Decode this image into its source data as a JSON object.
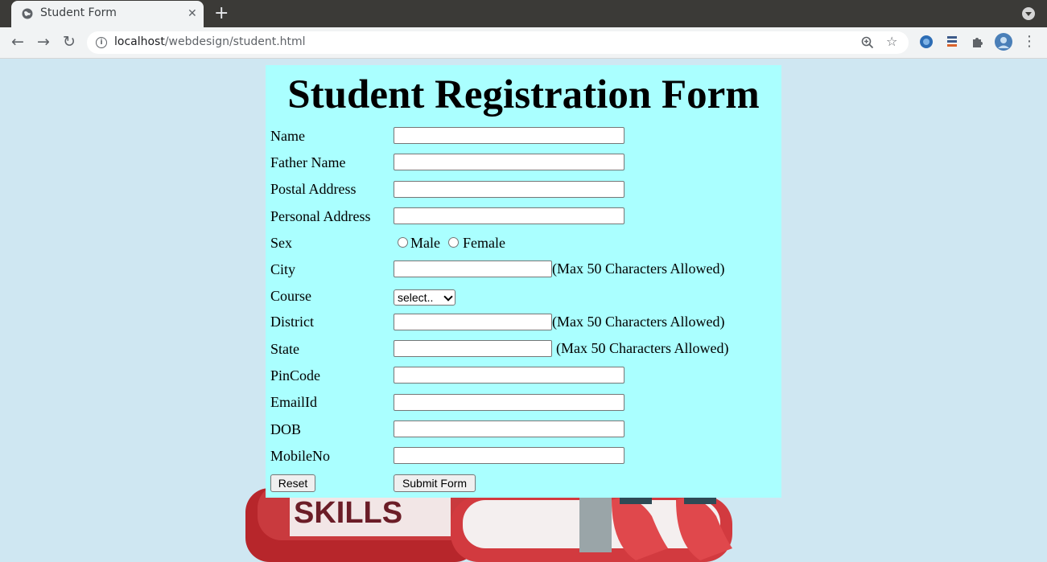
{
  "browser": {
    "tab_title": "Student Form",
    "url_host": "localhost",
    "url_path": "/webdesign/student.html"
  },
  "form": {
    "title": "Student Registration Form",
    "labels": {
      "name": "Name",
      "father_name": "Father Name",
      "postal_address": "Postal Address",
      "personal_address": "Personal Address",
      "sex": "Sex",
      "city": "City",
      "course": "Course",
      "district": "District",
      "state": "State",
      "pincode": "PinCode",
      "email": "EmailId",
      "dob": "DOB",
      "mobile": "MobileNo"
    },
    "sex_options": {
      "male": "Male",
      "female": "Female"
    },
    "hints": {
      "city": "(Max 50 Characters Allowed)",
      "district": "(Max 50 Characters Allowed)",
      "state": "(Max 50 Characters Allowed)"
    },
    "course_selected": "select..",
    "buttons": {
      "reset": "Reset",
      "submit": "Submit Form"
    },
    "background_text": "SKILLS"
  },
  "colors": {
    "page_bg": "#cfe7f2",
    "form_bg": "#aaffff"
  }
}
